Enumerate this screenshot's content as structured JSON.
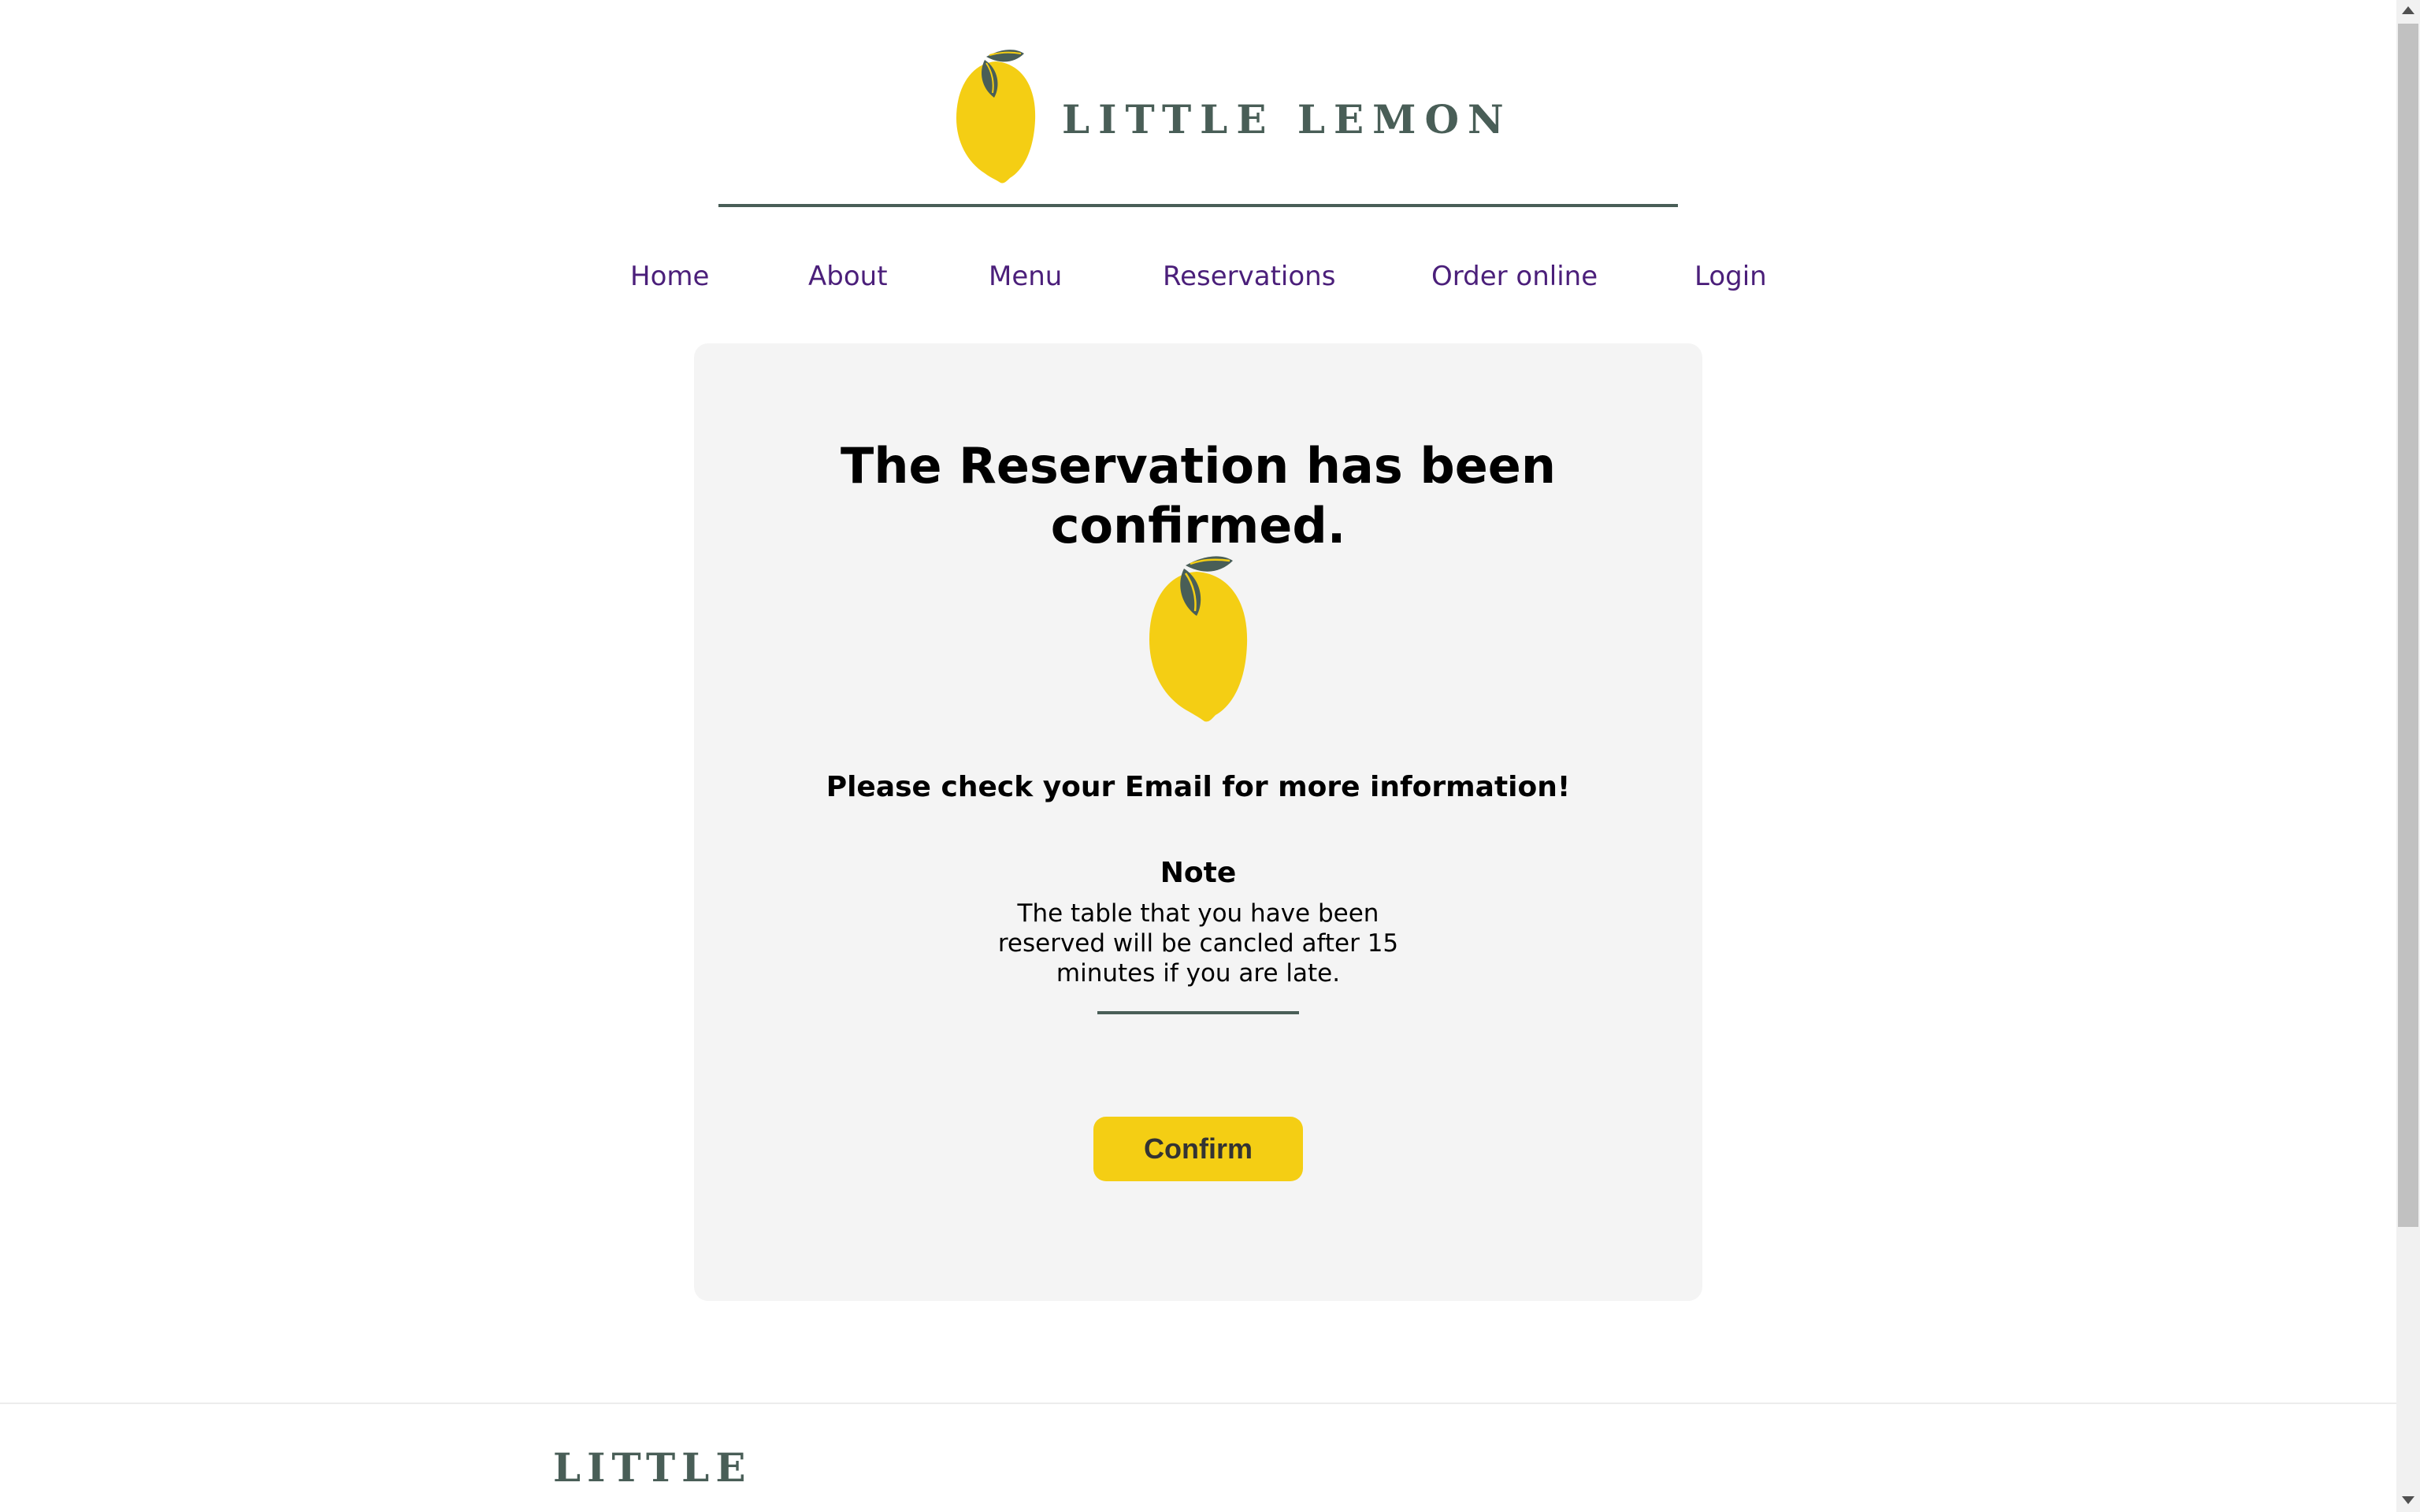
{
  "header": {
    "brand_text": "LITTLE LEMON",
    "logo_icon": "lemon-icon"
  },
  "nav": {
    "items": [
      {
        "label": "Home"
      },
      {
        "label": "About"
      },
      {
        "label": "Menu"
      },
      {
        "label": "Reservations"
      },
      {
        "label": "Order online"
      },
      {
        "label": "Login"
      }
    ],
    "link_color": "#4b1f7a"
  },
  "confirmation": {
    "title": "The Reservation has been confirmed.",
    "icon": "lemon-icon",
    "subtitle": "Please check your Email for more information!",
    "note_heading": "Note",
    "note_body": "The table that you have been reserved will be cancled after 15 minutes if you are late.",
    "confirm_label": "Confirm"
  },
  "footer": {
    "brand_text": "LITTLE"
  },
  "colors": {
    "brand_green": "#495e57",
    "brand_yellow": "#f4ce14",
    "card_background": "#f4f4f4"
  }
}
